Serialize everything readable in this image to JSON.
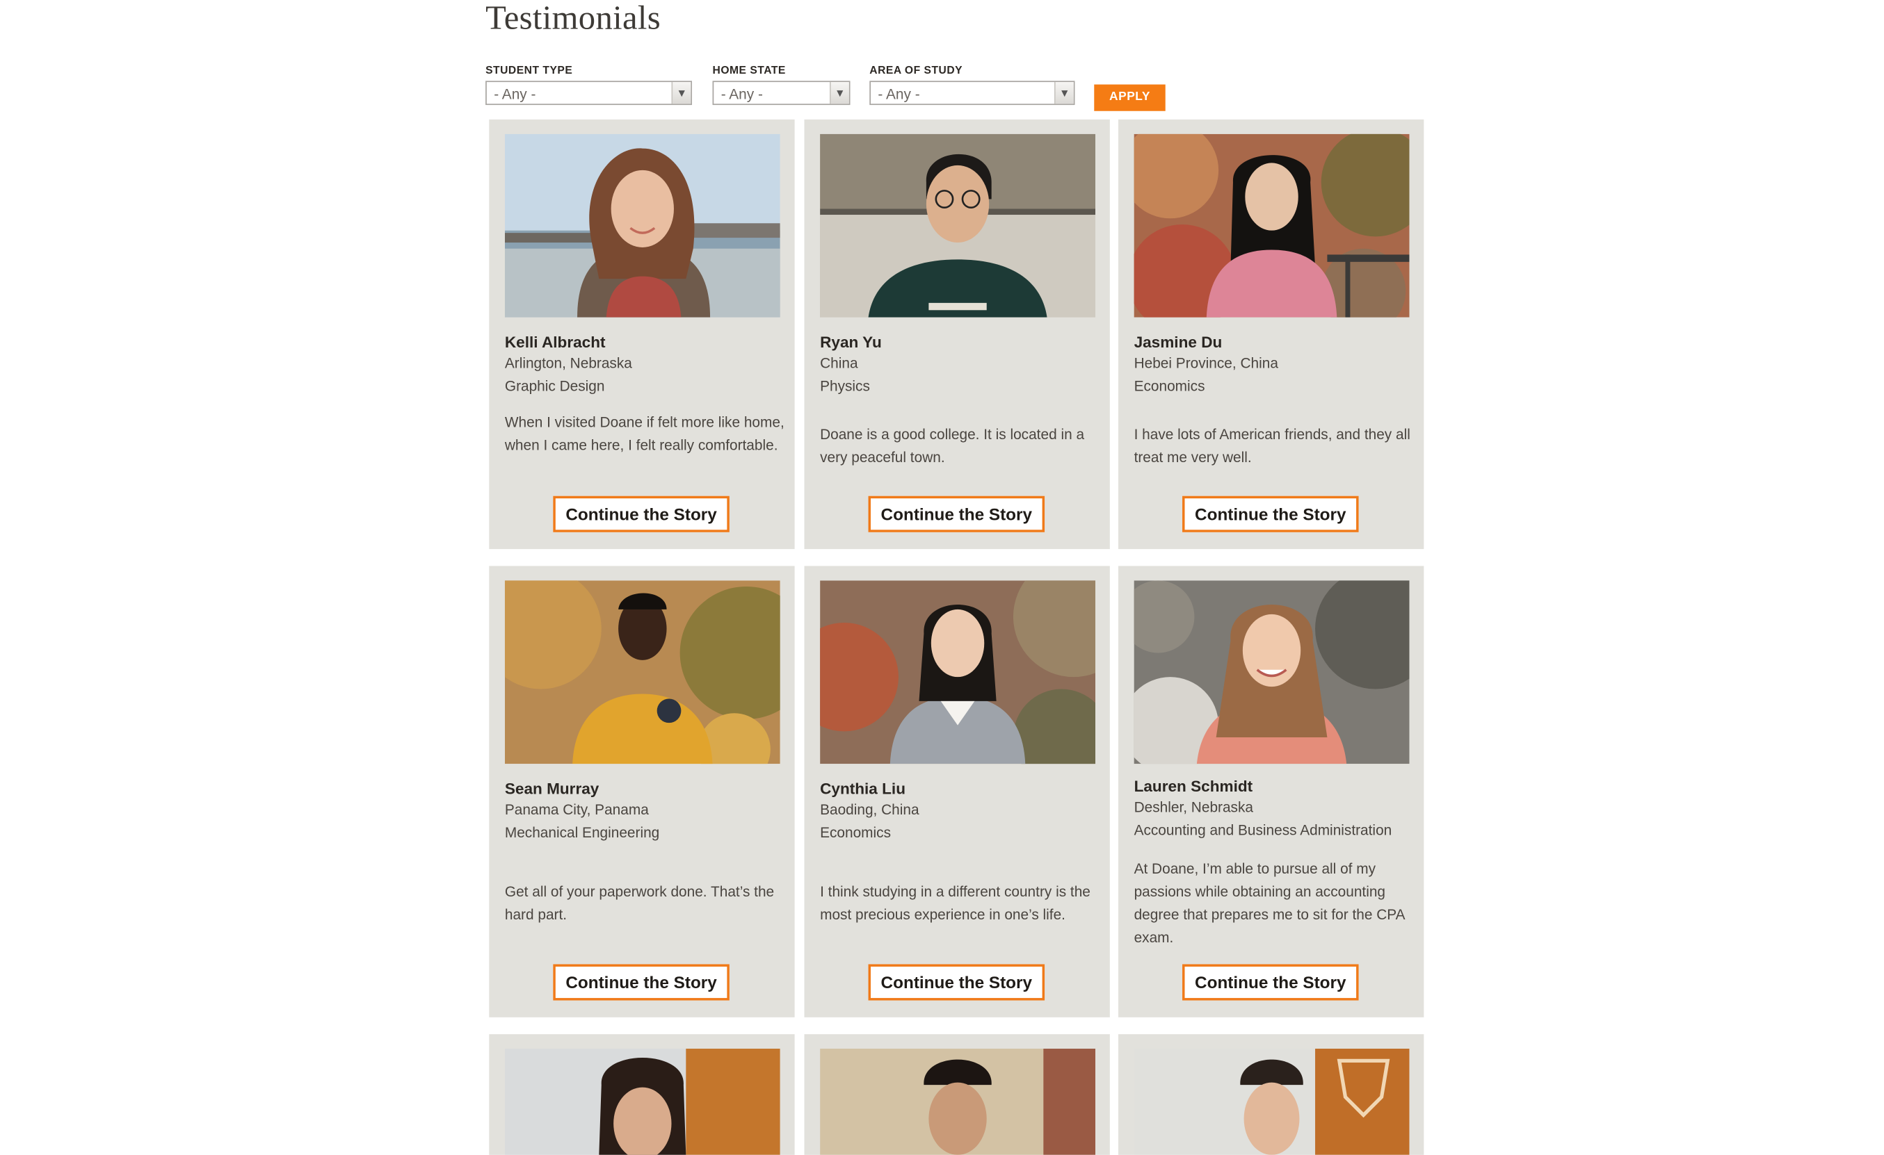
{
  "page": {
    "title": "Testimonials"
  },
  "filters": {
    "student_type": {
      "label": "STUDENT TYPE",
      "value": "- Any -"
    },
    "home_state": {
      "label": "HOME STATE",
      "value": "- Any -"
    },
    "area_of_study": {
      "label": "AREA OF STUDY",
      "value": "- Any -"
    },
    "apply_label": "APPLY"
  },
  "cards": [
    {
      "name": "Kelli Albracht",
      "location": "Arlington, Nebraska",
      "major": "Graphic Design",
      "quote": "When I visited Doane if felt more like home, when I came here, I felt really comfortable.",
      "button": "Continue the Story"
    },
    {
      "name": "Ryan Yu",
      "location": "China",
      "major": "Physics",
      "quote": "Doane is a good college. It is located in a very peaceful town.",
      "button": "Continue the Story"
    },
    {
      "name": "Jasmine Du",
      "location": "Hebei Province, China",
      "major": "Economics",
      "quote": "I have lots of American friends, and they all treat me very well.",
      "button": "Continue the Story"
    },
    {
      "name": "Sean Murray",
      "location": "Panama City, Panama",
      "major": "Mechanical Engineering",
      "quote": "Get all of your paperwork done. That’s the hard part.",
      "button": "Continue the Story"
    },
    {
      "name": "Cynthia Liu",
      "location": "Baoding, China",
      "major": "Economics",
      "quote": "I think studying in a different country is the most precious experience in one’s life.",
      "button": "Continue the Story"
    },
    {
      "name": "Lauren Schmidt",
      "location": "Deshler, Nebraska",
      "major": "Accounting and Business Administration",
      "quote": "At Doane, I’m able to pursue all of my passions while obtaining an accounting degree that prepares me to sit for the CPA exam.",
      "button": "Continue the Story"
    }
  ]
}
